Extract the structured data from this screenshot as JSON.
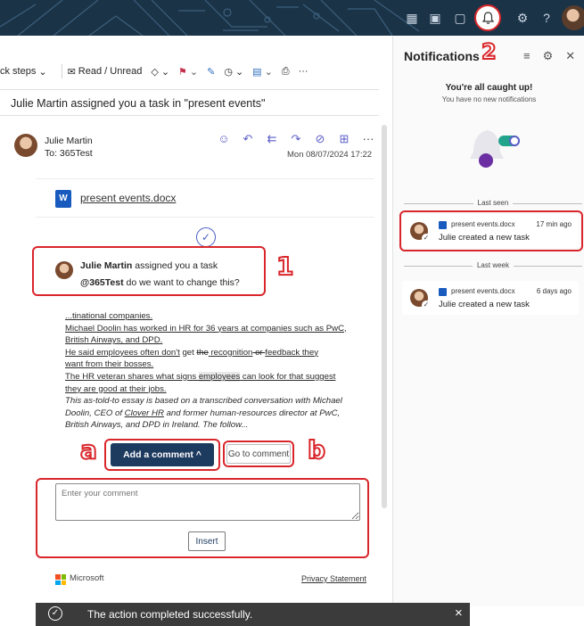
{
  "banner": {
    "icons": [
      "apps-icon",
      "outlook-icon",
      "teams-icon",
      "bell-icon",
      "settings-icon",
      "help-icon",
      "profile-avatar"
    ],
    "accent": "#1b3347"
  },
  "toolbar": {
    "quick_steps": "ck steps",
    "read_unread": "Read / Unread",
    "more": "···"
  },
  "mail": {
    "subject": "Julie Martin assigned you a task in \"present events\"",
    "sender": "Julie Martin",
    "to": "To:  365Test",
    "date": "Mon 08/07/2024 17:22",
    "attachment": "present events.docx",
    "task": {
      "author": "Julie Martin",
      "assigned_text": " assigned you a task",
      "mention": "@365Test",
      "comment": " do we want to change this?"
    },
    "excerpt": {
      "l1": "...tinational companies.",
      "l2": "Michael Doolin has worked in HR for 36 years at companies such as PwC,",
      "l3": "British Airways, and DPD.",
      "l4a": "He said employees often ",
      "l4b": "don't",
      "l4c": " get ",
      "l4d": "the",
      "l4e": " recognition",
      "l4f": " or ",
      "l4g": "feedback they",
      "l5": "want from their bosses.",
      "l6a": "The HR veteran shares what signs ",
      "l6b": "employees",
      "l6c": " can look for that suggest",
      "l7": "they are good at their jobs.",
      "l8": "This as-told-to essay is based on a transcribed conversation with Michael",
      "l9a": "Doolin, CEO of ",
      "l9b": "Clover HR",
      "l9c": " and former human-resources director at PwC,",
      "l10": "British Airways, and DPD in Ireland. The follow..."
    },
    "add_comment": "Add a comment ^",
    "go_to_comment": "Go to comment",
    "comment_placeholder": "Enter your comment",
    "insert": "Insert",
    "footer_brand": "Microsoft",
    "privacy": "Privacy Statement"
  },
  "callouts": {
    "one": "1",
    "two": "2",
    "a": "a",
    "b": "b",
    "color": "#d9262b"
  },
  "notifications": {
    "title": "Notifications",
    "caught_up": "You're all caught up!",
    "no_new": "You have no new notifications",
    "last_seen": "Last seen",
    "last_week": "Last week",
    "items": [
      {
        "doc": "present events.docx",
        "time": "17 min ago",
        "message": "Julie created a new task"
      },
      {
        "doc": "present events.docx",
        "time": "6 days ago",
        "message": "Julie created a new task"
      }
    ]
  },
  "toast": {
    "text": "The action completed successfully.",
    "close": "×"
  }
}
